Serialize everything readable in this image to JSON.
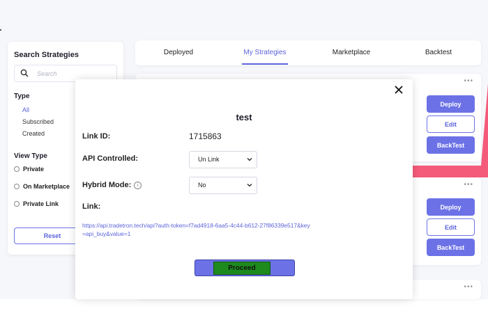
{
  "sidebar": {
    "title": "Search Strategies",
    "search_placeholder": "Search",
    "type_title": "Type",
    "type_items": [
      "All",
      "Subscribed",
      "Created"
    ],
    "view_type_title": "View Type",
    "view_type_items": [
      "Private",
      "On Marketplace",
      "Private Link"
    ],
    "reset_label": "Reset"
  },
  "tabs": [
    "Deployed",
    "My Strategies",
    "Marketplace",
    "Backtest"
  ],
  "active_tab": "My Strategies",
  "cards": [
    {
      "more": "•••",
      "deploy": "Deploy",
      "edit": "Edit",
      "backtest": "BackTest"
    },
    {
      "more": "•••",
      "deploy": "Deploy",
      "edit": "Edit",
      "backtest": "BackTest"
    },
    {
      "more": "•••"
    }
  ],
  "modal": {
    "title": "test",
    "link_id_label": "Link ID:",
    "link_id_value": "1715863",
    "api_controlled_label": "API Controlled:",
    "api_controlled_value": "Un Link",
    "hybrid_mode_label": "Hybrid Mode:",
    "hybrid_mode_value": "No",
    "link_label": "Link:",
    "link_url": "https://api.tradetron.tech/api?auth-token=f7ad4918-6aa5-4c44-b612-27f86339e517&key=api_buy&value=1",
    "proceed_label": "Proceed"
  },
  "colors": {
    "accent": "#6c72e6",
    "accent_text": "#5b63d9",
    "pink": "#f45b7a",
    "proceed_green": "#1e8a1e"
  }
}
